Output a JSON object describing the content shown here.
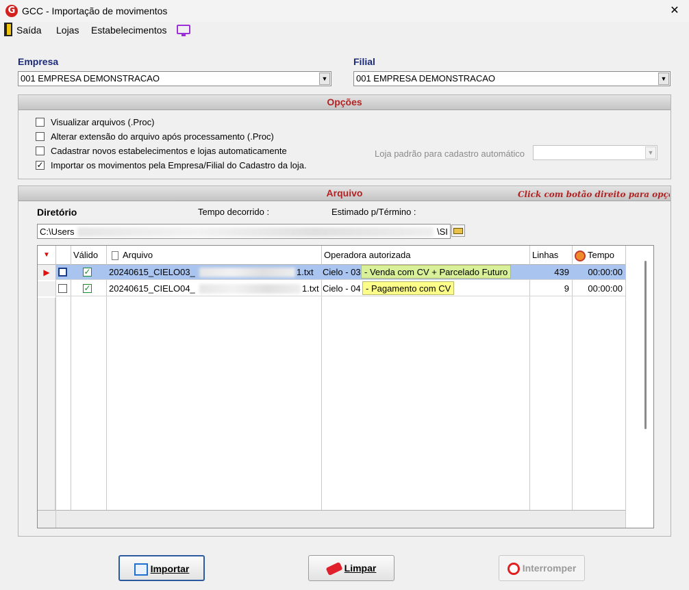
{
  "window": {
    "title": "GCC - Importação de movimentos",
    "logo_letter": "G",
    "close_glyph": "✕"
  },
  "menu": {
    "items": [
      "Saída",
      "Lojas",
      "Estabelecimentos"
    ]
  },
  "empresa": {
    "label": "Empresa",
    "value": "001 EMPRESA DEMONSTRACAO"
  },
  "filial": {
    "label": "Filial",
    "value": "001 EMPRESA DEMONSTRACAO"
  },
  "opcoes": {
    "title": "Opções",
    "checkboxes": [
      {
        "label": "Visualizar arquivos (.Proc)",
        "checked": false
      },
      {
        "label": "Alterar extensão do arquivo após processamento (.Proc)",
        "checked": false
      },
      {
        "label": "Cadastrar novos estabelecimentos e lojas automaticamente",
        "checked": false
      },
      {
        "label": "Importar os movimentos pela Empresa/Filial do Cadastro da loja.",
        "checked": true
      }
    ],
    "loja_padrao_label": "Loja padrão para cadastro automático",
    "loja_padrao_value": ""
  },
  "arquivo": {
    "title": "Arquivo",
    "hint": "Click com botão direito para opções",
    "diretorio_label": "Diretório",
    "tempo_label": "Tempo decorrido :",
    "estimado_label": "Estimado p/Término :",
    "path_start": "C:\\Users",
    "path_end": "\\SI"
  },
  "grid": {
    "headers": {
      "valido": "Válido",
      "arquivo": "Arquivo",
      "operadora": "Operadora autorizada",
      "linhas": "Linhas",
      "tempo": "Tempo"
    },
    "rows": [
      {
        "arquivo_prefix": "20240615_CIELO03_",
        "arquivo_suffix": "1.txt",
        "operadora": "Cielo - 03",
        "operadora_desc": "- Venda com CV + Parcelado Futuro",
        "linhas": "439",
        "tempo": "00:00:00",
        "valido": true,
        "selected": true
      },
      {
        "arquivo_prefix": "20240615_CIELO04_",
        "arquivo_suffix": "1.txt",
        "operadora": "Cielo - 04",
        "operadora_desc": "- Pagamento com CV",
        "linhas": "9",
        "tempo": "00:00:00",
        "valido": true,
        "selected": false
      }
    ]
  },
  "buttons": {
    "importar": "Importar",
    "limpar": "Limpar",
    "interromper": "Interromper"
  },
  "colors": {
    "accent": "#b22222",
    "label_blue": "#1b2a7a",
    "selection": "#a9c4ee"
  }
}
